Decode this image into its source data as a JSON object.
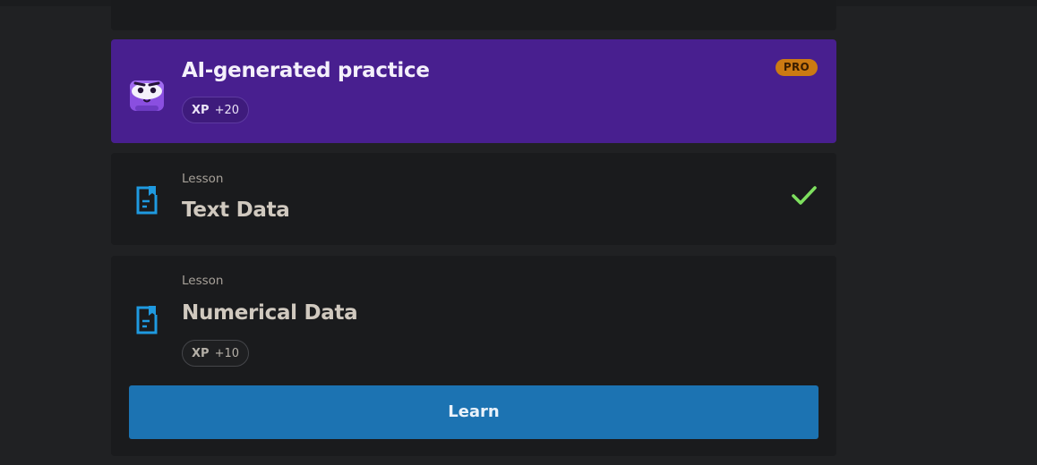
{
  "ai_practice": {
    "title": "AI-generated practice",
    "badge": "PRO",
    "xp_label": "XP",
    "xp_value": "+20",
    "icon": "mascot-icon"
  },
  "lessons": [
    {
      "type": "Lesson",
      "title": "Text Data",
      "icon": "document-icon",
      "completed": true,
      "status_icon": "check-icon"
    },
    {
      "type": "Lesson",
      "title": "Numerical Data",
      "icon": "document-icon",
      "xp_label": "XP",
      "xp_value": "+10",
      "button_label": "Learn"
    }
  ],
  "colors": {
    "page_background": "#202123",
    "card_background": "#1a1b1d",
    "ai_card_background": "#481f8f",
    "pro_badge": "#cc7a12",
    "check_green": "#7ee05f",
    "doc_icon_blue": "#1f9ae0",
    "learn_button": "#1c73b2"
  }
}
